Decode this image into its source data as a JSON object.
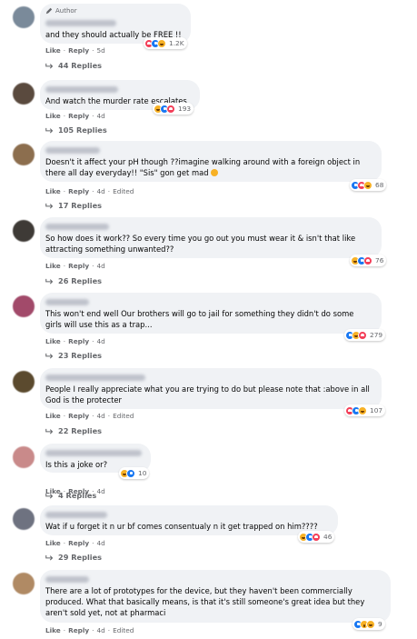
{
  "feed": {
    "author_label": "Author",
    "comments": [
      {
        "text": "and they should actually be FREE !!",
        "reactions": [
          "love",
          "like",
          "haha"
        ],
        "reaction_count": "1.2K",
        "like_label": "Like",
        "reply_label": "Reply",
        "time": "5d",
        "edited": "",
        "replies": "44 Replies",
        "avatar_color": "#7a8a9a"
      },
      {
        "text": "And watch the murder rate escalates",
        "reactions": [
          "haha",
          "like",
          "love"
        ],
        "reaction_count": "193",
        "like_label": "Like",
        "reply_label": "Reply",
        "time": "4d",
        "edited": "",
        "replies": "105 Replies",
        "avatar_color": "#5a4a3e"
      },
      {
        "text": "Doesn't it affect your pH though ??imagine walking around with a foreign object in\nthere all day everyday!! \"Sis\" gon get mad",
        "reactions": [
          "like",
          "love",
          "haha"
        ],
        "reaction_count": "68",
        "like_label": "Like",
        "reply_label": "Reply",
        "time": "4d",
        "edited": "Edited",
        "replies": "17 Replies",
        "avatar_color": "#8c6e4e"
      },
      {
        "text": "So how does it work?? So every time you go out you must wear it & isn't that like\nattracting something unwanted??",
        "reactions": [
          "haha",
          "like",
          "love"
        ],
        "reaction_count": "76",
        "like_label": "Like",
        "reply_label": "Reply",
        "time": "4d",
        "edited": "",
        "replies": "26 Replies",
        "avatar_color": "#3e3a36"
      },
      {
        "text": "This won't end well Our brothers will go to jail for something they didn't do some\ngirls will use this as a trap...",
        "reactions": [
          "like",
          "haha",
          "love"
        ],
        "reaction_count": "279",
        "like_label": "Like",
        "reply_label": "Reply",
        "time": "4d",
        "edited": "",
        "replies": "23 Replies",
        "avatar_color": "#a24a6a"
      },
      {
        "text": "People I really appreciate what you are trying to do but please note that :above in all\nGod is the protecter",
        "reactions": [
          "love",
          "like",
          "haha"
        ],
        "reaction_count": "107",
        "like_label": "Like",
        "reply_label": "Reply",
        "time": "4d",
        "edited": "Edited",
        "replies": "22 Replies",
        "avatar_color": "#5b4a2e"
      },
      {
        "text": "Is this a joke or?",
        "reactions": [
          "haha",
          "like"
        ],
        "reaction_count": "10",
        "like_label": "Like",
        "reply_label": "Reply",
        "time": "4d",
        "edited": "",
        "replies": "4 Replies",
        "avatar_color": "#c98a8a"
      },
      {
        "text": "Wat if u forget it n ur bf comes consentualy n it get trapped on him????",
        "reactions": [
          "haha",
          "like",
          "love"
        ],
        "reaction_count": "46",
        "like_label": "Like",
        "reply_label": "Reply",
        "time": "4d",
        "edited": "",
        "replies": "29 Replies",
        "avatar_color": "#6e7280"
      },
      {
        "text": "There are a lot of prototypes for the device, but they haven't been commercially\nproduced. What that basically means, is that it's still someone's great idea but they\naren't sold yet, not at pharmaci",
        "reactions": [
          "like",
          "wow",
          "haha"
        ],
        "reaction_count": "9",
        "like_label": "Like",
        "reply_label": "Reply",
        "time": "4d",
        "edited": "Edited",
        "replies": "",
        "avatar_color": "#b08a64"
      }
    ]
  }
}
